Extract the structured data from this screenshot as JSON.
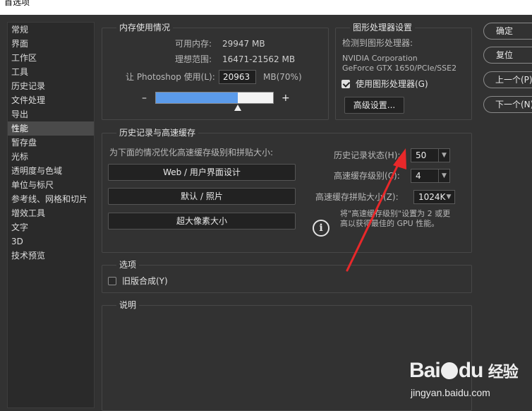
{
  "window": {
    "title": "首选项"
  },
  "sidebar": {
    "items": [
      {
        "label": "常规"
      },
      {
        "label": "界面"
      },
      {
        "label": "工作区"
      },
      {
        "label": "工具"
      },
      {
        "label": "历史记录"
      },
      {
        "label": "文件处理"
      },
      {
        "label": "导出"
      },
      {
        "label": "性能",
        "active": true
      },
      {
        "label": "暂存盘"
      },
      {
        "label": "光标"
      },
      {
        "label": "透明度与色域"
      },
      {
        "label": "单位与标尺"
      },
      {
        "label": "参考线、网格和切片"
      },
      {
        "label": "增效工具"
      },
      {
        "label": "文字"
      },
      {
        "label": "3D"
      },
      {
        "label": "技术预览"
      }
    ]
  },
  "memory": {
    "title": "内存使用情况",
    "available_label": "可用内存:",
    "available_value": "29947 MB",
    "ideal_label": "理想范围:",
    "ideal_value": "16471-21562 MB",
    "let_label": "让 Photoshop 使用(L):",
    "let_value": "20963",
    "unit": "MB(70%)",
    "minus": "–",
    "plus": "+",
    "slider_fraction": 0.7
  },
  "gpu": {
    "title": "图形处理器设置",
    "detected_label": "检测到图形处理器:",
    "vendor": "NVIDIA Corporation",
    "model": "GeForce GTX 1650/PCIe/SSE2",
    "use_gpu_label": "使用图形处理器(G)",
    "use_gpu_checked": true,
    "advanced_button": "高级设置..."
  },
  "buttons": {
    "ok": "确定",
    "reset": "复位",
    "prev": "上一个(P)",
    "next": "下一个(N)"
  },
  "history_cache": {
    "title": "历史记录与高速缓存",
    "optimize_label": "为下面的情况优化高速缓存级别和拼贴大小:",
    "btn_web": "Web / 用户界面设计",
    "btn_default": "默认 / 照片",
    "btn_huge": "超大像素大小",
    "history_states_label": "历史记录状态(H):",
    "history_states_value": "50",
    "cache_levels_label": "高速缓存级别(C):",
    "cache_levels_value": "4",
    "tile_size_label": "高速缓存拼贴大小(Z):",
    "tile_size_value": "1024K",
    "info_line1": "将\"高速缓存级别\"设置为 2 或更",
    "info_line2": "高以获得最佳的 GPU 性能。"
  },
  "options": {
    "title": "选项",
    "legacy_label": "旧版合成(Y)",
    "legacy_checked": false
  },
  "description": {
    "title": "说明"
  },
  "watermark": {
    "brand": "Bai",
    "brand2": "du",
    "jingyan": "经验",
    "url": "jingyan.baidu.com"
  },
  "colors": {
    "accent": "#5b9bea",
    "arrow": "#e8282a"
  }
}
